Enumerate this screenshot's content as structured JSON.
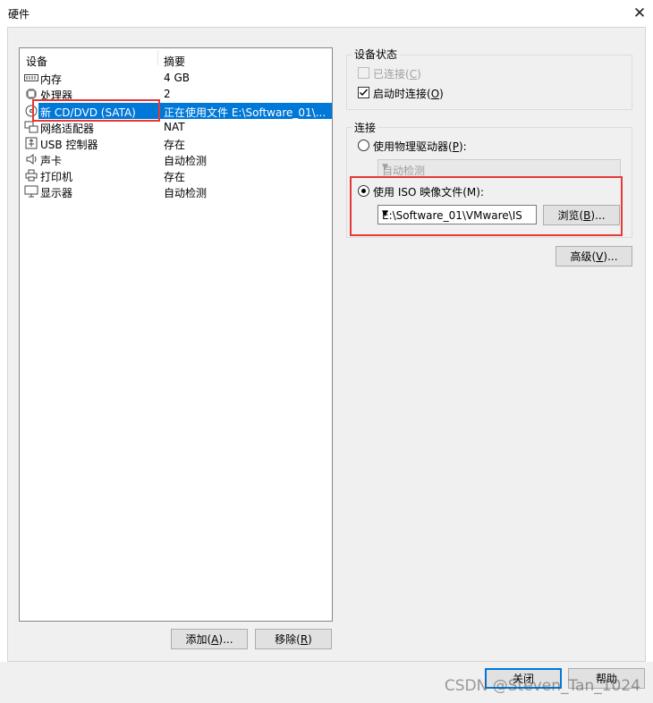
{
  "window": {
    "title": "硬件"
  },
  "devices": {
    "col_device": "设备",
    "col_summary": "摘要",
    "rows": [
      {
        "icon": "memory-icon",
        "name": "内存",
        "summary": "4 GB"
      },
      {
        "icon": "processor-icon",
        "name": "处理器",
        "summary": "2"
      },
      {
        "icon": "cd-dvd-icon",
        "name": "新 CD/DVD (SATA)",
        "summary": "正在使用文件 E:\\Software_01\\..."
      },
      {
        "icon": "network-adapter-icon",
        "name": "网络适配器",
        "summary": "NAT"
      },
      {
        "icon": "usb-icon",
        "name": "USB 控制器",
        "summary": "存在"
      },
      {
        "icon": "sound-card-icon",
        "name": "声卡",
        "summary": "自动检测"
      },
      {
        "icon": "printer-icon",
        "name": "打印机",
        "summary": "存在"
      },
      {
        "icon": "display-icon",
        "name": "显示器",
        "summary": "自动检测"
      }
    ],
    "selected_index": 2,
    "add_button": {
      "text": "添加(",
      "key": "A",
      "suffix": ")..."
    },
    "remove_button": {
      "text": "移除(",
      "key": "R",
      "suffix": ")"
    }
  },
  "device_status": {
    "title": "设备状态",
    "connected": {
      "text": "已连接(",
      "key": "C",
      "suffix": ")",
      "checked": false,
      "disabled": true
    },
    "connect_at_power_on": {
      "text": "启动时连接(",
      "key": "O",
      "suffix": ")",
      "checked": true
    }
  },
  "connection": {
    "title": "连接",
    "physical": {
      "text": "使用物理驱动器(",
      "key": "P",
      "suffix": "):",
      "selected": false
    },
    "physical_select": "自动检测",
    "iso": {
      "label": "使用 ISO 映像文件(M):",
      "selected": true
    },
    "iso_path": "E:\\Software_01\\VMware\\IS",
    "browse_button": {
      "text": "浏览(",
      "key": "B",
      "suffix": ")..."
    }
  },
  "advanced_button": {
    "text": "高级(",
    "key": "V",
    "suffix": ")..."
  },
  "footer": {
    "close_button": "关闭",
    "help_button": "帮助"
  },
  "watermark": "CSDN @Steven_Tan_1024",
  "colors": {
    "selection": "#0078d7",
    "highlight_box": "#e53935",
    "dialog_bg": "#f0f0f0"
  }
}
